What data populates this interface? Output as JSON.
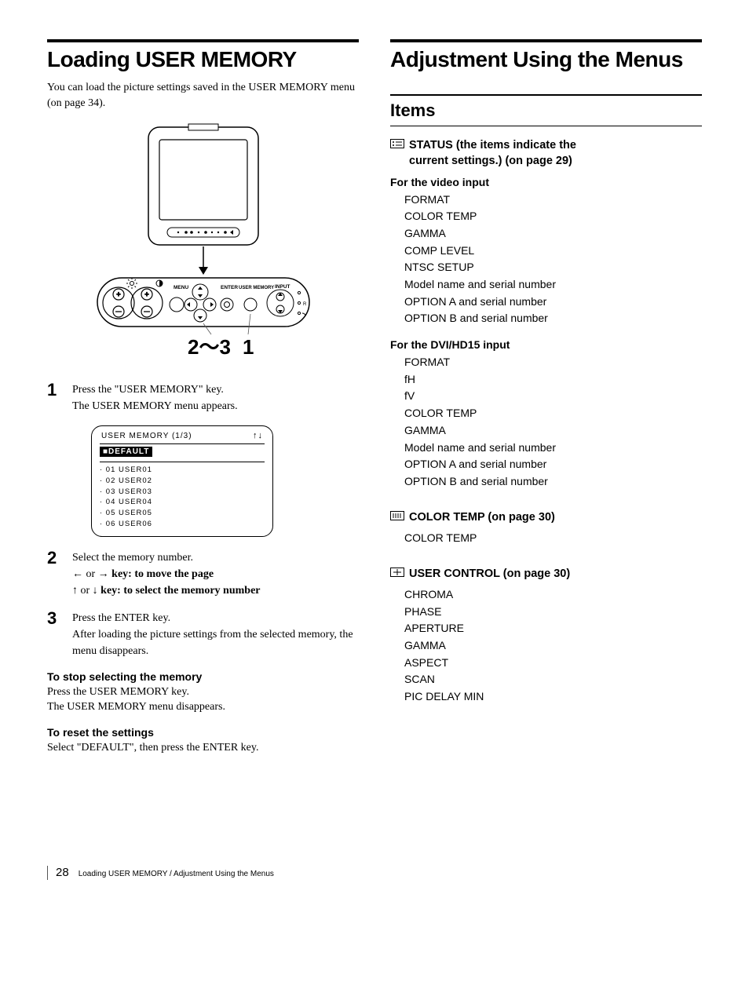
{
  "left": {
    "title": "Loading USER MEMORY",
    "intro": "You can load the picture settings saved in the USER MEMORY menu (on page 34).",
    "panel_labels": {
      "menu": "MENU",
      "enter": "ENTER",
      "usermem": "USER MEMORY",
      "input": "INPUT",
      "r": "R"
    },
    "pointer_a": "2～3",
    "pointer_b": "1",
    "step1_num": "1",
    "step1_a": "Press the \"USER MEMORY\" key.",
    "step1_b": "The USER MEMORY menu appears.",
    "menu": {
      "title": "USER MEMORY (1/3)",
      "default": "■DEFAULT",
      "items": [
        "· 01 USER01",
        "· 02 USER02",
        "· 03 USER03",
        "· 04 USER04",
        "· 05 USER05",
        "· 06 USER06"
      ]
    },
    "step2_num": "2",
    "step2_a": "Select the memory number.",
    "step2_b_pre": "← ",
    "step2_b_or": "or",
    "step2_b_post": " → key: to move the page",
    "step2_c_pre": "↑ ",
    "step2_c_or": "or",
    "step2_c_post": " ↓ key: to select the memory number",
    "step3_num": "3",
    "step3_a": "Press the ENTER key.",
    "step3_b": "After loading the picture settings from the selected memory, the menu disappears.",
    "stop_head": "To stop selecting the memory",
    "stop_a": "Press the USER MEMORY key.",
    "stop_b": "The USER MEMORY menu disappears.",
    "reset_head": "To reset the settings",
    "reset_a": "Select \"DEFAULT\", then press the ENTER key."
  },
  "right": {
    "title": "Adjustment Using the Menus",
    "items_heading": "Items",
    "status_head_a": "STATUS (the items indicate the",
    "status_head_b": "current settings.) (on page 29)",
    "video_sub": "For the video input",
    "video_items": [
      "FORMAT",
      "COLOR TEMP",
      "GAMMA",
      "COMP LEVEL",
      "NTSC SETUP",
      "Model name and serial number",
      "OPTION A and serial number",
      "OPTION B and serial number"
    ],
    "dvi_sub": "For the DVI/HD15 input",
    "dvi_items": [
      "FORMAT",
      "fH",
      "fV",
      "COLOR TEMP",
      "GAMMA",
      "Model name and serial number",
      "OPTION A and serial number",
      "OPTION B and serial number"
    ],
    "ct_head": "COLOR TEMP (on page 30)",
    "ct_items": [
      "COLOR TEMP"
    ],
    "uc_head": "USER CONTROL (on page 30)",
    "uc_items": [
      "CHROMA",
      "PHASE",
      "APERTURE",
      "GAMMA",
      "ASPECT",
      "SCAN",
      "PIC DELAY MIN"
    ]
  },
  "footer": {
    "page": "28",
    "text": "Loading USER MEMORY / Adjustment Using the Menus"
  }
}
